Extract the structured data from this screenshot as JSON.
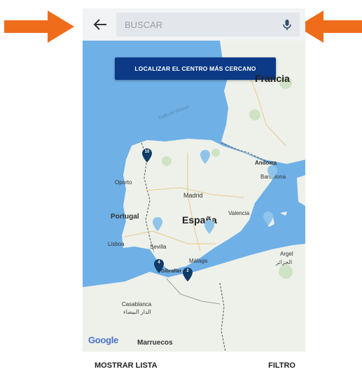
{
  "search": {
    "placeholder": "BUSCAR",
    "back_icon": "arrow-left-icon",
    "mic_icon": "microphone-icon"
  },
  "map": {
    "locate_button_label": "LOCALIZAR EL CENTRO MÁS CERCANO",
    "labels": {
      "francia": "Francia",
      "golfo": "Golfo de Vizcaya",
      "andorra": "Andorra",
      "barcelona": "Barcelona",
      "oporto": "Oporto",
      "madrid": "Madrid",
      "portugal": "Portugal",
      "espana": "España",
      "valencia": "Valencia",
      "lisboa": "Lisboa",
      "sevilla": "Sevilla",
      "malaga": "Málaga",
      "gibraltar": "Gibraltar",
      "argel": "Argel",
      "argel_ar": "الجزائر",
      "casablanca": "Casablanca",
      "casablanca_ar": "الدار البيضاء",
      "marruecos": "Marruecos"
    },
    "pins": [
      {
        "count": "10"
      },
      {
        "count": ""
      },
      {
        "count": ""
      },
      {
        "count": ""
      },
      {
        "count": ""
      },
      {
        "count": ""
      },
      {
        "count": "4"
      },
      {
        "count": "2"
      }
    ],
    "attribution": "Google"
  },
  "bottom": {
    "list_label": "MOSTRAR LISTA",
    "filter_label": "FILTRO"
  },
  "colors": {
    "accent_arrow": "#ef6c1a",
    "button_bg": "#0c3a86",
    "sea": "#6fb0e6",
    "land": "#eef0ea"
  }
}
